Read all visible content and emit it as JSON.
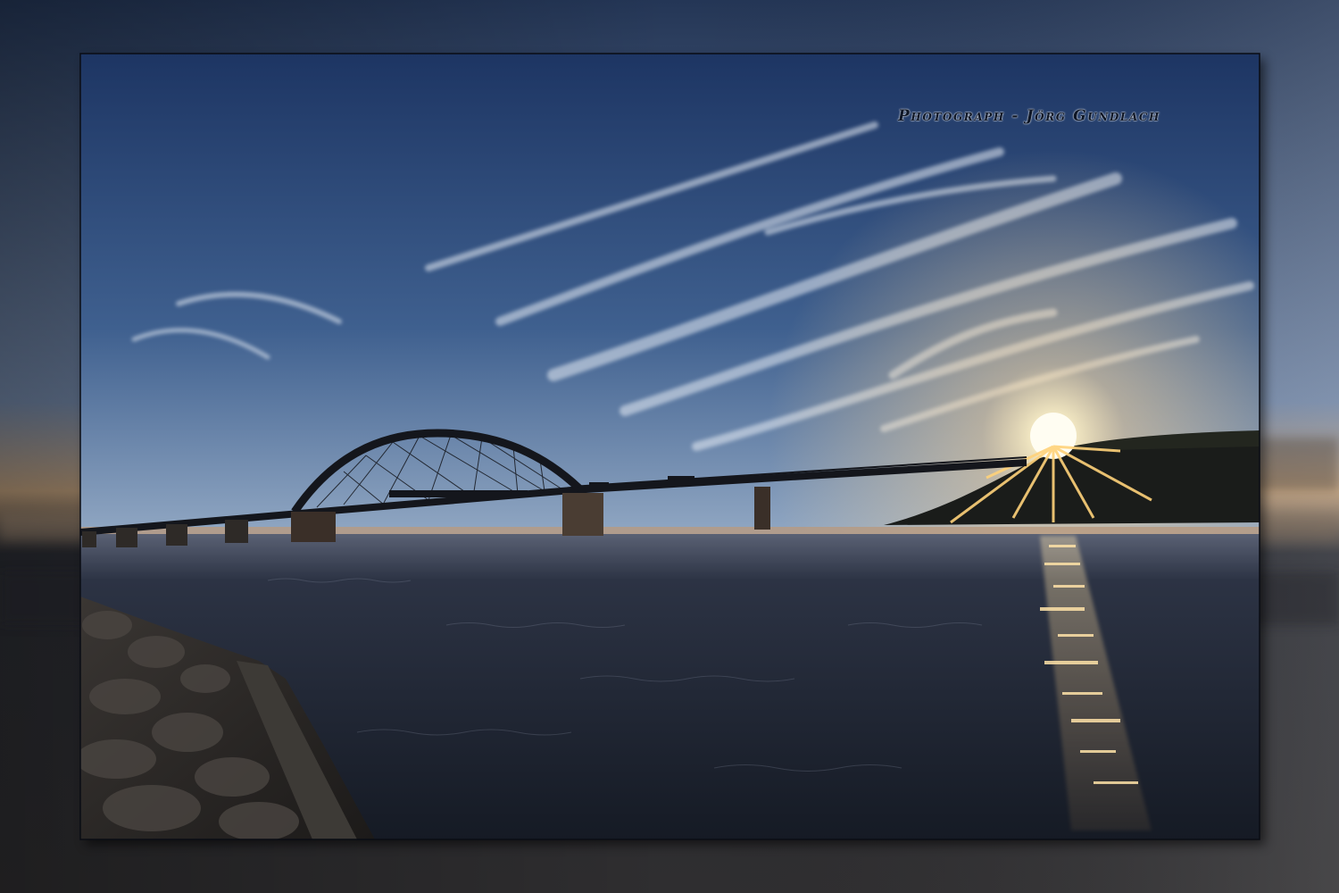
{
  "watermark": {
    "text": "Photograph  - Jörg Gundlach"
  },
  "colors": {
    "sky_top": "#1f3a6a",
    "sky_mid": "#6f8fb4",
    "horizon_glow": "#f2c48a",
    "sun": "#fff6d8",
    "water": "#1e2636",
    "silhouette": "#15171d",
    "border_shadow": "#0c0f16"
  },
  "icons": [
    "bridge-silhouette",
    "sun-starburst",
    "rock-shore",
    "sun-reflection"
  ]
}
